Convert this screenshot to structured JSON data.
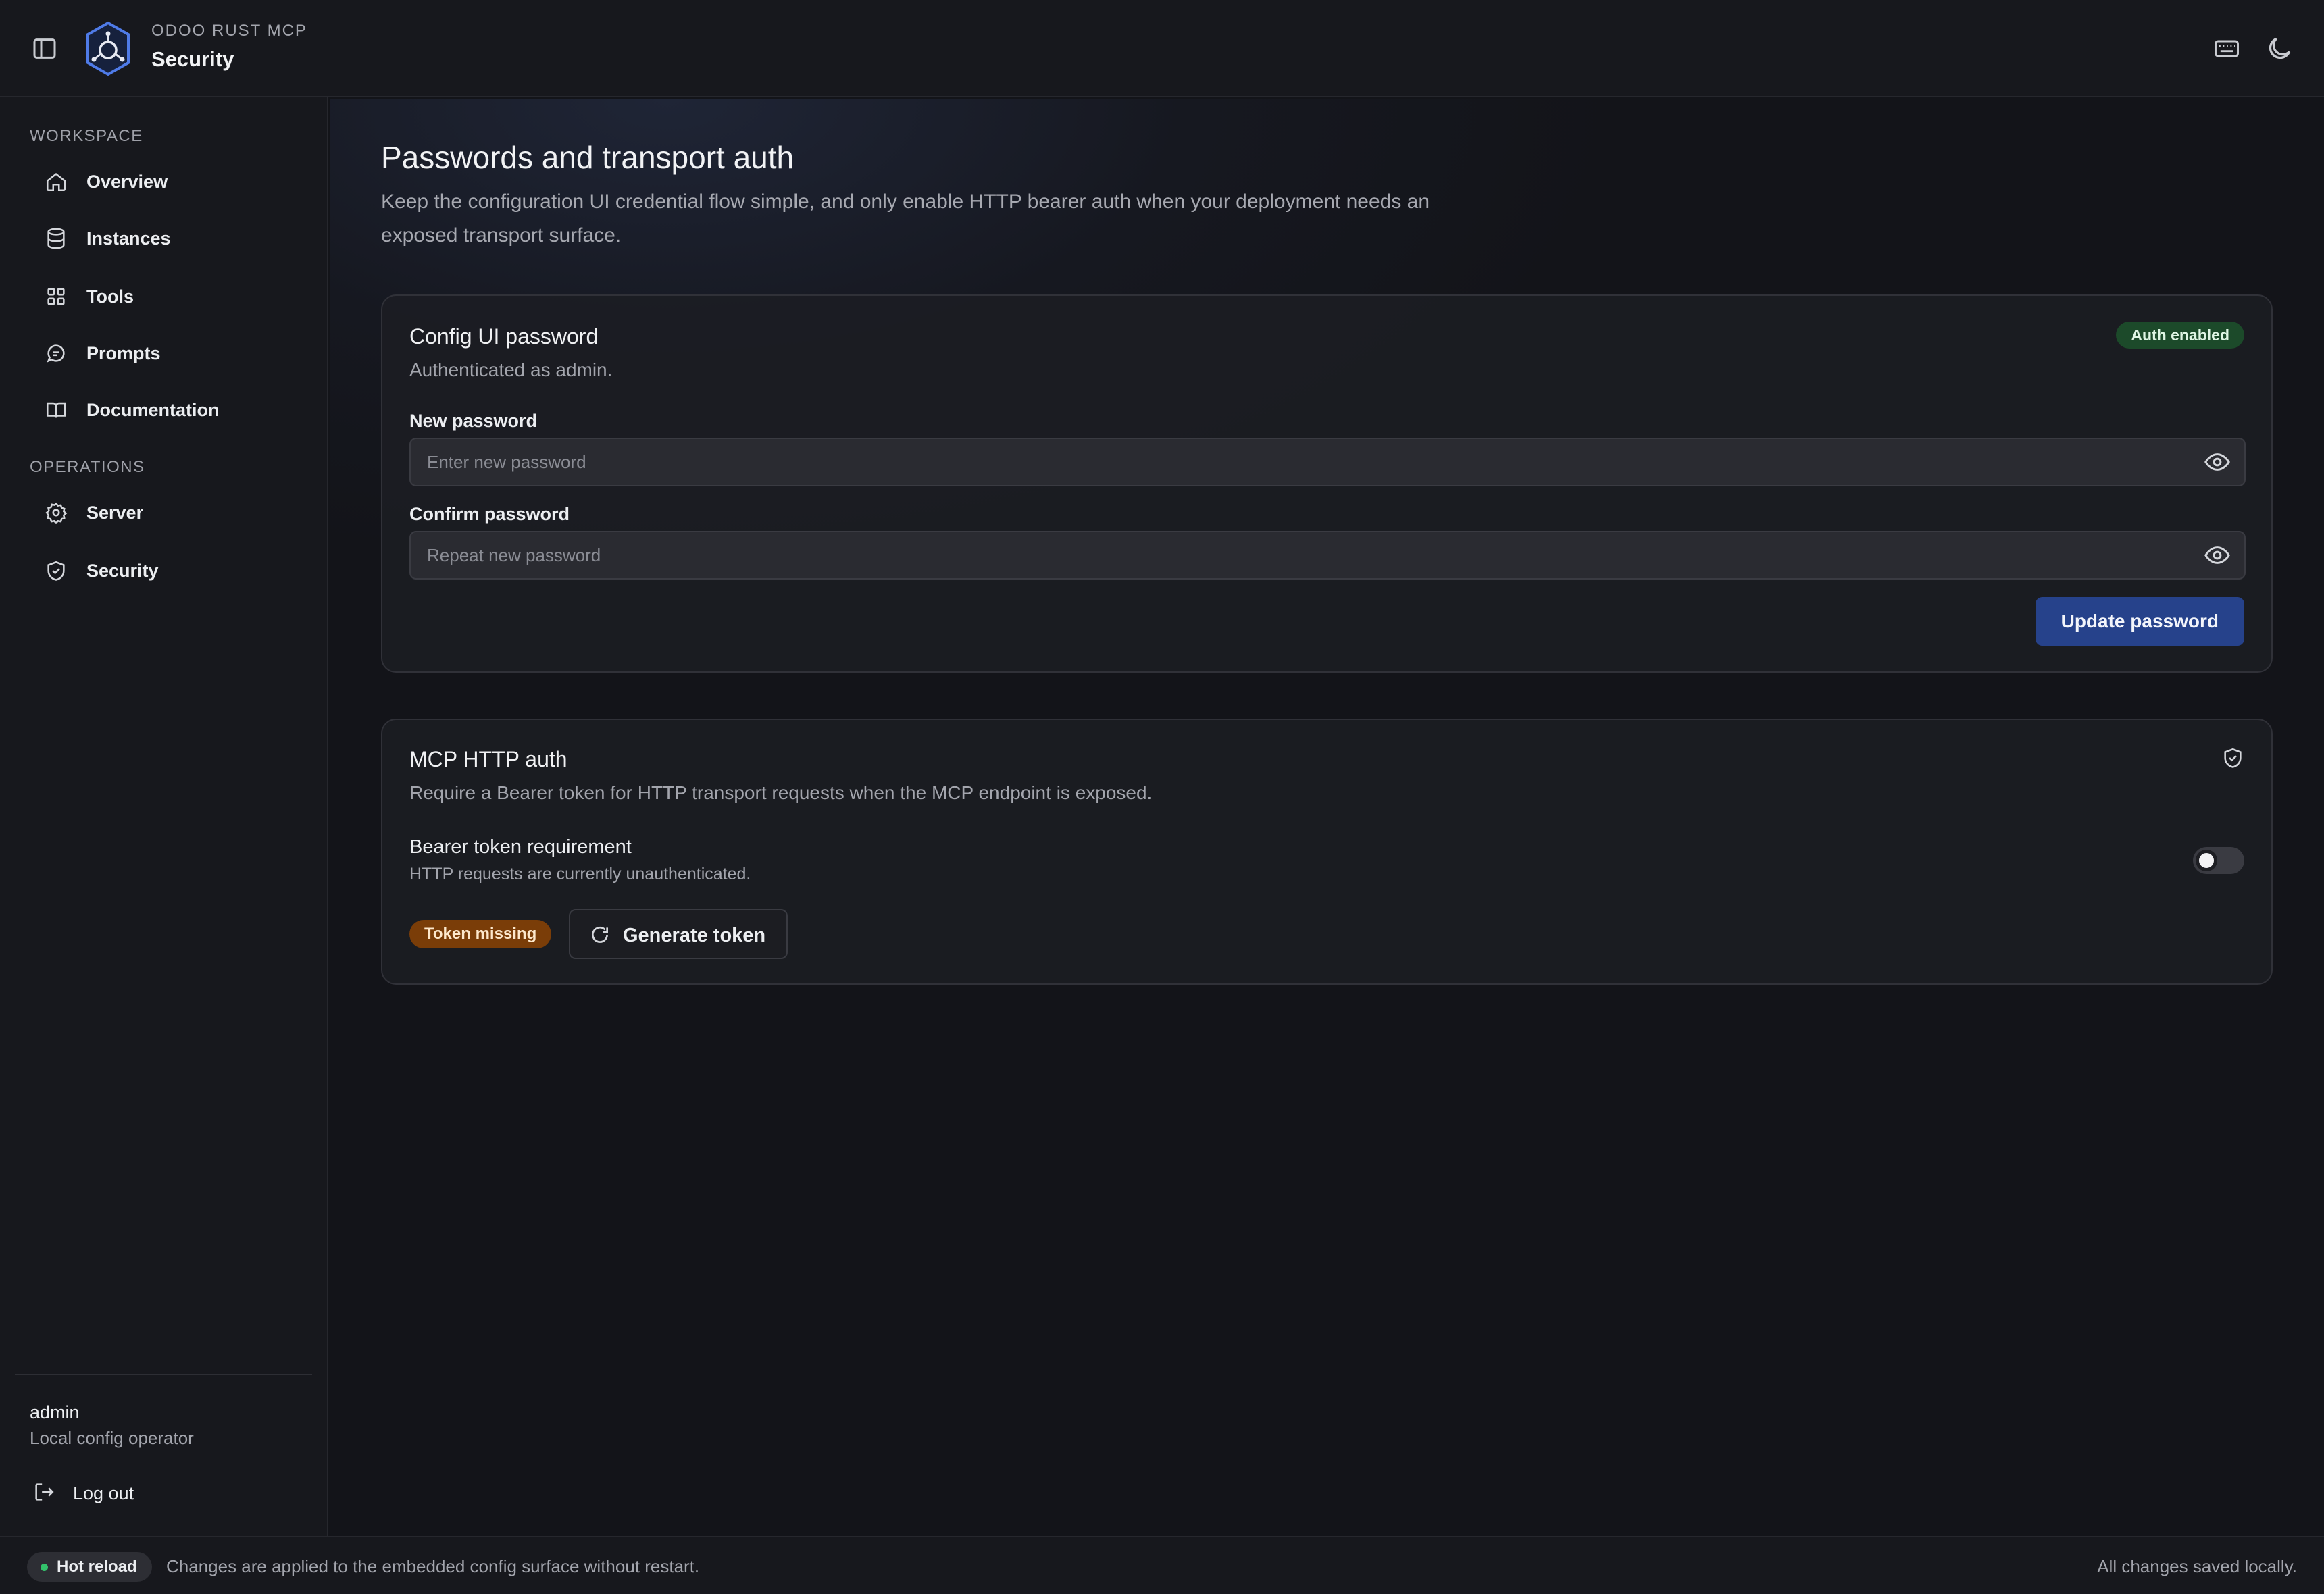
{
  "header": {
    "app_name": "ODOO RUST MCP",
    "section": "Security"
  },
  "sidebar": {
    "workspace_label": "WORKSPACE",
    "workspace_items": [
      {
        "label": "Overview",
        "icon": "home-icon"
      },
      {
        "label": "Instances",
        "icon": "database-icon"
      },
      {
        "label": "Tools",
        "icon": "grid-icon"
      },
      {
        "label": "Prompts",
        "icon": "chat-icon"
      },
      {
        "label": "Documentation",
        "icon": "book-icon"
      }
    ],
    "operations_label": "OPERATIONS",
    "operations_items": [
      {
        "label": "Server",
        "icon": "gear-icon"
      },
      {
        "label": "Security",
        "icon": "shield-icon"
      }
    ],
    "user": {
      "name": "admin",
      "role": "Local config operator"
    },
    "logout_label": "Log out"
  },
  "page": {
    "title": "Passwords and transport auth",
    "description": "Keep the configuration UI credential flow simple, and only enable HTTP bearer auth when your deployment needs an exposed transport surface."
  },
  "password_card": {
    "title": "Config UI password",
    "subtitle": "Authenticated as admin.",
    "badge": "Auth enabled",
    "new_password_label": "New password",
    "new_password_placeholder": "Enter new password",
    "new_password_value": "",
    "confirm_password_label": "Confirm password",
    "confirm_password_placeholder": "Repeat new password",
    "confirm_password_value": "",
    "submit_label": "Update password"
  },
  "http_auth_card": {
    "title": "MCP HTTP auth",
    "subtitle": "Require a Bearer token for HTTP transport requests when the MCP endpoint is exposed.",
    "bearer_title": "Bearer token requirement",
    "bearer_subtitle": "HTTP requests are currently unauthenticated.",
    "bearer_enabled": false,
    "token_badge": "Token missing",
    "generate_label": "Generate token"
  },
  "footer": {
    "hot_reload_label": "Hot reload",
    "message": "Changes are applied to the embedded config surface without restart.",
    "saved_status": "All changes saved locally."
  },
  "colors": {
    "accent": "#26428b",
    "success_badge": "#1c4a2a",
    "warning_badge": "#7a3d08",
    "background": "#131419"
  }
}
